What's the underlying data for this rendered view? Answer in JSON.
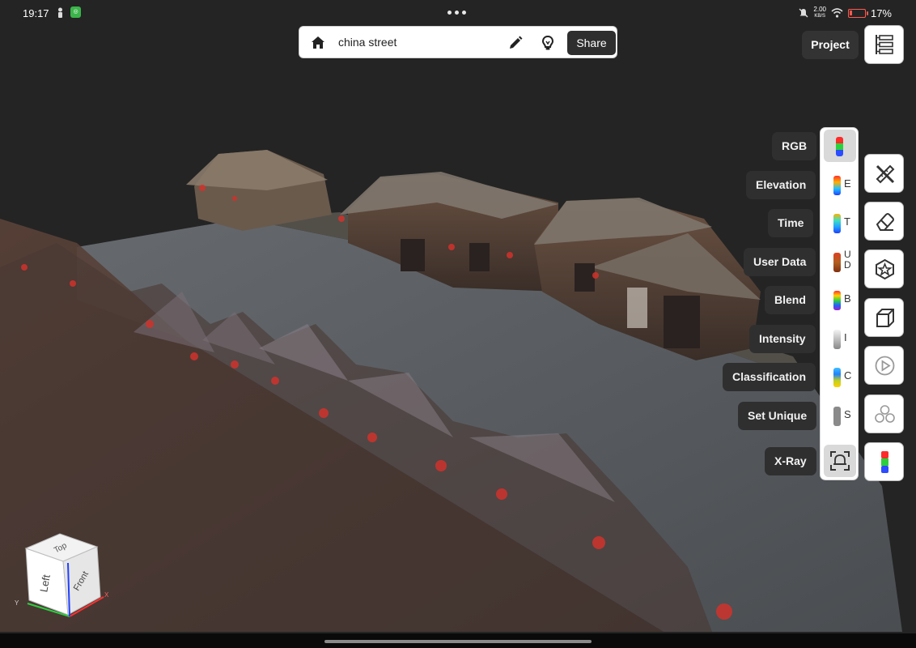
{
  "status_bar": {
    "time": "19:17",
    "net_speed_value": "2.00",
    "net_speed_unit": "KB/S",
    "battery_percent": "17%",
    "battery_level": 0.17,
    "battery_color": "#ff5a4f"
  },
  "toolbar": {
    "home_icon": "home-icon",
    "project_name": "china street",
    "edit_icon": "pencil-icon",
    "tips_icon": "lightbulb-icon",
    "share_label": "Share"
  },
  "project_button": {
    "label": "Project",
    "tree_icon": "layer-tree-icon"
  },
  "color_modes": {
    "active": "RGB",
    "items": [
      {
        "label": "RGB",
        "letter": "",
        "icon": "rgb-swatch-icon"
      },
      {
        "label": "Elevation",
        "letter": "E",
        "icon": "elevation-swatch-icon"
      },
      {
        "label": "Time",
        "letter": "T",
        "icon": "time-swatch-icon"
      },
      {
        "label": "User Data",
        "letter": "U\nD",
        "icon": "user-data-swatch-icon"
      },
      {
        "label": "Blend",
        "letter": "B",
        "icon": "blend-swatch-icon"
      },
      {
        "label": "Intensity",
        "letter": "I",
        "icon": "intensity-swatch-icon"
      },
      {
        "label": "Classification",
        "letter": "C",
        "icon": "classification-swatch-icon"
      },
      {
        "label": "Set Unique",
        "letter": "S",
        "icon": "set-unique-swatch-icon"
      },
      {
        "label": "X-Ray",
        "letter": "",
        "icon": "xray-icon"
      }
    ]
  },
  "tools": {
    "measure_icon": "measure-tools-icon",
    "clip_icon": "eraser-icon",
    "annotation_icon": "star-annotation-icon",
    "box_icon": "clip-box-icon",
    "animation_icon": "play-animation-icon",
    "shapes_icon": "shapes-icon",
    "color_mode_icon": "color-mode-icon"
  },
  "nav_cube": {
    "top": "Top",
    "left": "Left",
    "front": "Front",
    "axis_x": "X",
    "axis_y": "Y"
  },
  "colors": {
    "accent": "#2e2e2e",
    "panel": "#ffffff",
    "label_bg": "#2f2f2f"
  }
}
